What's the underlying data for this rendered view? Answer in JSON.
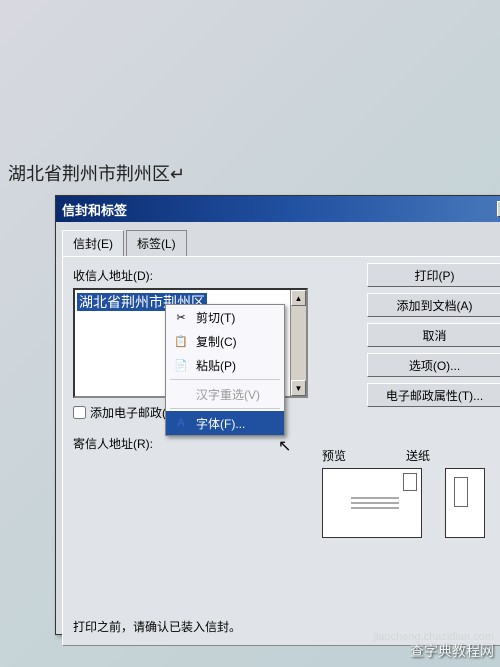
{
  "document": {
    "text": "湖北省荆州市荆州区↵"
  },
  "dialog": {
    "title": "信封和标签",
    "close": "×",
    "tabs": {
      "envelope": "信封(E)",
      "labels": "标签(L)"
    },
    "recipient_label": "收信人地址(D):",
    "recipient_value": "湖北省荆州市荆州区",
    "email_checkbox": "添加电子邮政(C)",
    "sender_label": "寄信人地址(R):",
    "preview_label": "预览",
    "feed_label": "送纸",
    "hint": "打印之前，请确认已装入信封。",
    "buttons": {
      "print": "打印(P)",
      "add_doc": "添加到文档(A)",
      "cancel": "取消",
      "options": "选项(O)...",
      "postal": "电子邮政属性(T)..."
    }
  },
  "context_menu": {
    "cut": "剪切(T)",
    "copy": "复制(C)",
    "paste": "粘贴(P)",
    "reconvert": "汉字重选(V)",
    "font": "字体(F)..."
  },
  "icons": {
    "cut": "✂",
    "copy": "📋",
    "paste": "📄",
    "font": "A"
  },
  "watermark": {
    "line1": "查字典教程网",
    "line2": "jiaocheng.chazidian.com"
  }
}
